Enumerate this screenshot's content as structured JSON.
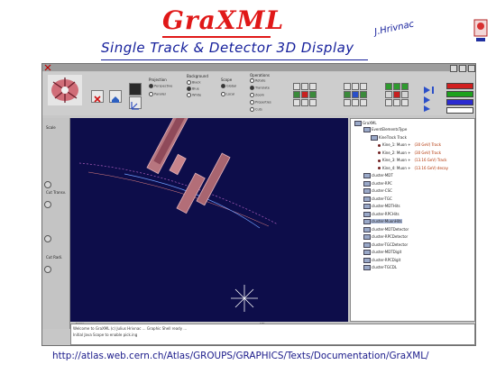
{
  "header": {
    "title": "GraXML",
    "subtitle": "Single Track & Detector 3D Display",
    "author": "J.Hrivnac"
  },
  "window": {
    "toolbar": {
      "groups": [
        {
          "label": "Projection",
          "options": [
            "Perspective",
            "Parallel"
          ]
        },
        {
          "label": "Background",
          "options": [
            "Black",
            "Blue",
            "White"
          ]
        },
        {
          "label": "Scope",
          "options": [
            "Global",
            "Local"
          ]
        },
        {
          "label": "Operations",
          "options": [
            "Rotate",
            "Translate",
            "Zoom",
            "Properties",
            "Cuts"
          ]
        }
      ],
      "color_bars": [
        "#d11f1f",
        "#1da11d",
        "#2b2bd1",
        "#ffffff"
      ]
    },
    "left_panel": {
      "labels": [
        "Scale",
        "Cut Transv.",
        "Cut Radi."
      ]
    },
    "tree": {
      "root": "GraXML",
      "items": [
        {
          "label": "EventElementsType",
          "level": 1,
          "extra": ""
        },
        {
          "label": "KineTrack Track",
          "level": 2,
          "extra": ""
        },
        {
          "label": "Kine_1: Muon +",
          "level": 3,
          "extra": "(30 GeV) Track"
        },
        {
          "label": "Kine_2: Muon +",
          "level": 3,
          "extra": "(30 GeV) Track"
        },
        {
          "label": "Kine_3: Muon +",
          "level": 3,
          "extra": "(13.16 GeV) Track"
        },
        {
          "label": "Kine_4: Muon +",
          "level": 3,
          "extra": "(13.16 GeV) decay"
        },
        {
          "label": "cluster-MDT",
          "level": 1,
          "extra": ""
        },
        {
          "label": "cluster-RPC",
          "level": 1,
          "extra": ""
        },
        {
          "label": "cluster-CSC",
          "level": 1,
          "extra": ""
        },
        {
          "label": "cluster-TGC",
          "level": 1,
          "extra": ""
        },
        {
          "label": "cluster-MDTHits",
          "level": 1,
          "extra": ""
        },
        {
          "label": "cluster-RPCHits",
          "level": 1,
          "extra": ""
        },
        {
          "label": "cluster-MuonHits",
          "level": 1,
          "extra": ""
        },
        {
          "label": "cluster-MDTDetector",
          "level": 1,
          "extra": ""
        },
        {
          "label": "cluster-RPCDetector",
          "level": 1,
          "extra": ""
        },
        {
          "label": "cluster-TGCDetector",
          "level": 1,
          "extra": ""
        },
        {
          "label": "cluster-MDTDigit",
          "level": 1,
          "extra": ""
        },
        {
          "label": "cluster-RPCDigit",
          "level": 1,
          "extra": ""
        },
        {
          "label": "cluster-TGCDL",
          "level": 1,
          "extra": ""
        }
      ],
      "highlighted_index": 12
    },
    "tabs": [
      "Scene",
      "Info"
    ],
    "status_lines": [
      "Welcome to GraXML (c) Julius Hrivnac ... Graphic Shell ready ...",
      "Initial Java Scope to enable pick.ing"
    ]
  },
  "footer": {
    "url": "http://atlas.web.cern.ch/Atlas/GROUPS/GRAPHICS/Texts/Documentation/GraXML/"
  }
}
